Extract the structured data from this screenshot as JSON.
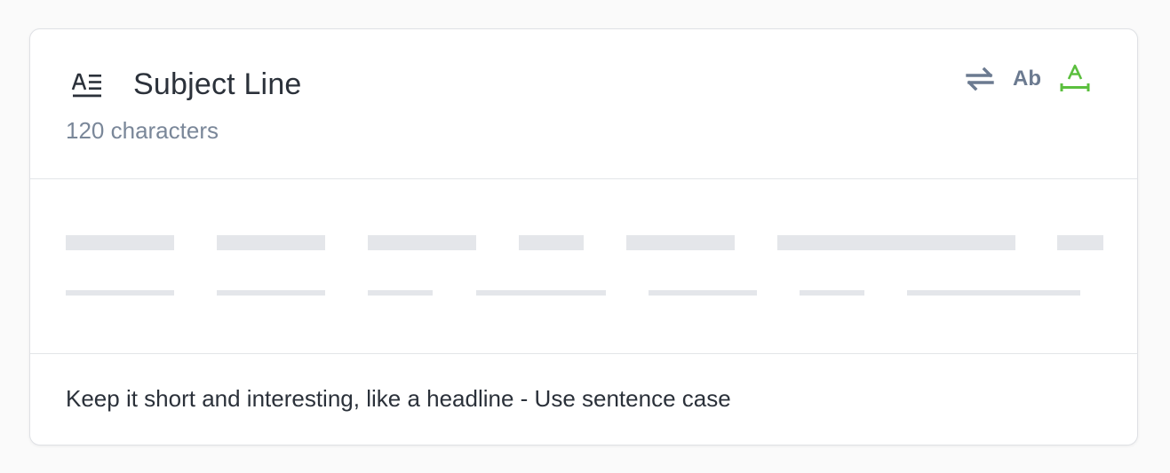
{
  "card": {
    "title": "Subject Line",
    "character_limit": "120 characters",
    "hint": "Keep it short and interesting, like a headline - Use sentence case"
  },
  "actions": {
    "swap_icon": "repeat-arrows-icon",
    "case_label": "Ab",
    "length_icon": "text-width-icon",
    "length_icon_color": "#5bbf3e"
  },
  "colors": {
    "title": "#2b313a",
    "subtitle": "#7a8799",
    "placeholder": "#e4e6ea",
    "icon_gray": "#6b7a90",
    "accent_green": "#5bbf3e"
  },
  "placeholder_rows": 2
}
